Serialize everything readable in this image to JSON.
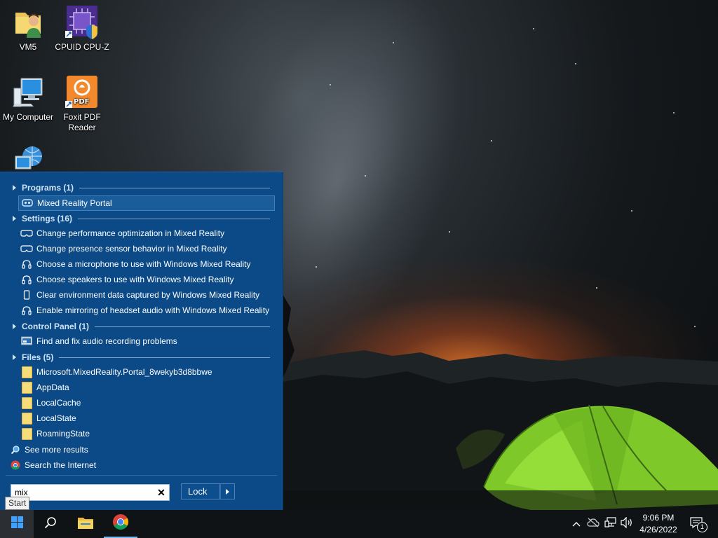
{
  "desktop": {
    "icons": [
      {
        "label": "VM5",
        "icon": "user-folder-icon"
      },
      {
        "label": "CPUID CPU-Z",
        "icon": "cpuz-icon"
      },
      {
        "label": "My Computer",
        "icon": "computer-icon"
      },
      {
        "label": "Foxit PDF Reader",
        "icon": "pdf-reader-icon"
      },
      {
        "label": "",
        "icon": "network-icon"
      }
    ]
  },
  "start_menu": {
    "sections": {
      "programs": {
        "label": "Programs (1)"
      },
      "settings": {
        "label": "Settings (16)"
      },
      "control_panel": {
        "label": "Control Panel (1)"
      },
      "files": {
        "label": "Files (5)"
      }
    },
    "programs": [
      {
        "label": "Mixed Reality Portal",
        "icon": "mixed-reality-icon",
        "selected": true
      }
    ],
    "settings": [
      {
        "label": "Change performance optimization in Mixed Reality",
        "icon": "headset-icon"
      },
      {
        "label": "Change presence sensor behavior in Mixed Reality",
        "icon": "headset-icon"
      },
      {
        "label": "Choose a microphone to use with Windows Mixed Reality",
        "icon": "headphones-icon"
      },
      {
        "label": "Choose speakers to use with Windows Mixed Reality",
        "icon": "headphones-icon"
      },
      {
        "label": "Clear environment data captured by Windows Mixed Reality",
        "icon": "device-icon"
      },
      {
        "label": "Enable mirroring of headset audio with Windows Mixed Reality",
        "icon": "headphones-icon"
      }
    ],
    "control_panel": [
      {
        "label": "Find and fix audio recording problems",
        "icon": "troubleshoot-icon"
      }
    ],
    "files": [
      {
        "label": "Microsoft.MixedReality.Portal_8wekyb3d8bbwe",
        "icon": "folder-icon"
      },
      {
        "label": "AppData",
        "icon": "folder-icon"
      },
      {
        "label": "LocalCache",
        "icon": "folder-icon"
      },
      {
        "label": "LocalState",
        "icon": "folder-icon"
      },
      {
        "label": "RoamingState",
        "icon": "folder-icon"
      }
    ],
    "see_more": "See more results",
    "search_internet": "Search the Internet",
    "search": {
      "value": "mix",
      "placeholder": ""
    },
    "lock_label": "Lock"
  },
  "tooltip": "Start",
  "taskbar": {
    "clock_time": "9:06 PM",
    "clock_date": "4/26/2022",
    "notification_count": "1"
  }
}
